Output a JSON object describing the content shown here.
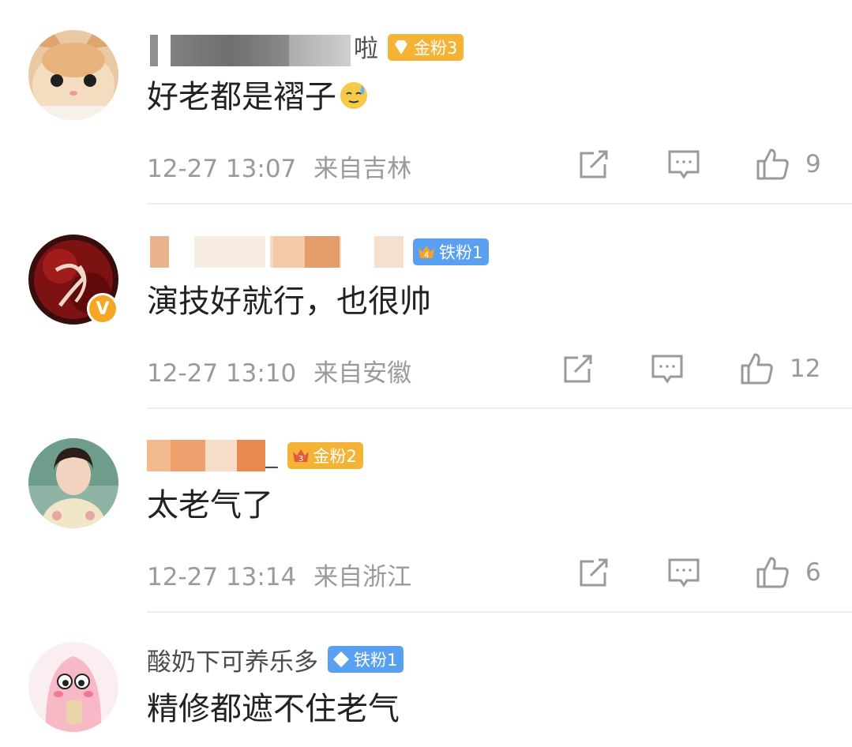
{
  "comments": [
    {
      "username_visible": "啦",
      "username_prefix": "",
      "fan_badge": "金粉3",
      "text": "好老都是褶子",
      "emoji": "sweat-smile-emoji",
      "time": "12-27 13:07",
      "location": "来自吉林",
      "likes": "9"
    },
    {
      "username_visible": "",
      "username_prefix": "",
      "fan_badge": "铁粉1",
      "badge_level": "4",
      "text": "演技好就行，也很帅",
      "time": "12-27 13:10",
      "location": "来自安徽",
      "likes": "12",
      "verified": "V"
    },
    {
      "username_visible": "_",
      "username_prefix": "",
      "fan_badge": "金粉2",
      "badge_level": "3",
      "text": "太老气了",
      "time": "12-27 13:14",
      "location": "来自浙江",
      "likes": "6"
    },
    {
      "username_visible": "酸奶下可养乐多",
      "username_prefix": "",
      "fan_badge": "铁粉1",
      "text": "精修都遮不住老气"
    }
  ],
  "colors": {
    "gold_badge": "#f5b335",
    "iron_badge": "#5aa0f0",
    "meta_text": "#9a9a9a",
    "body_text": "#222222"
  }
}
